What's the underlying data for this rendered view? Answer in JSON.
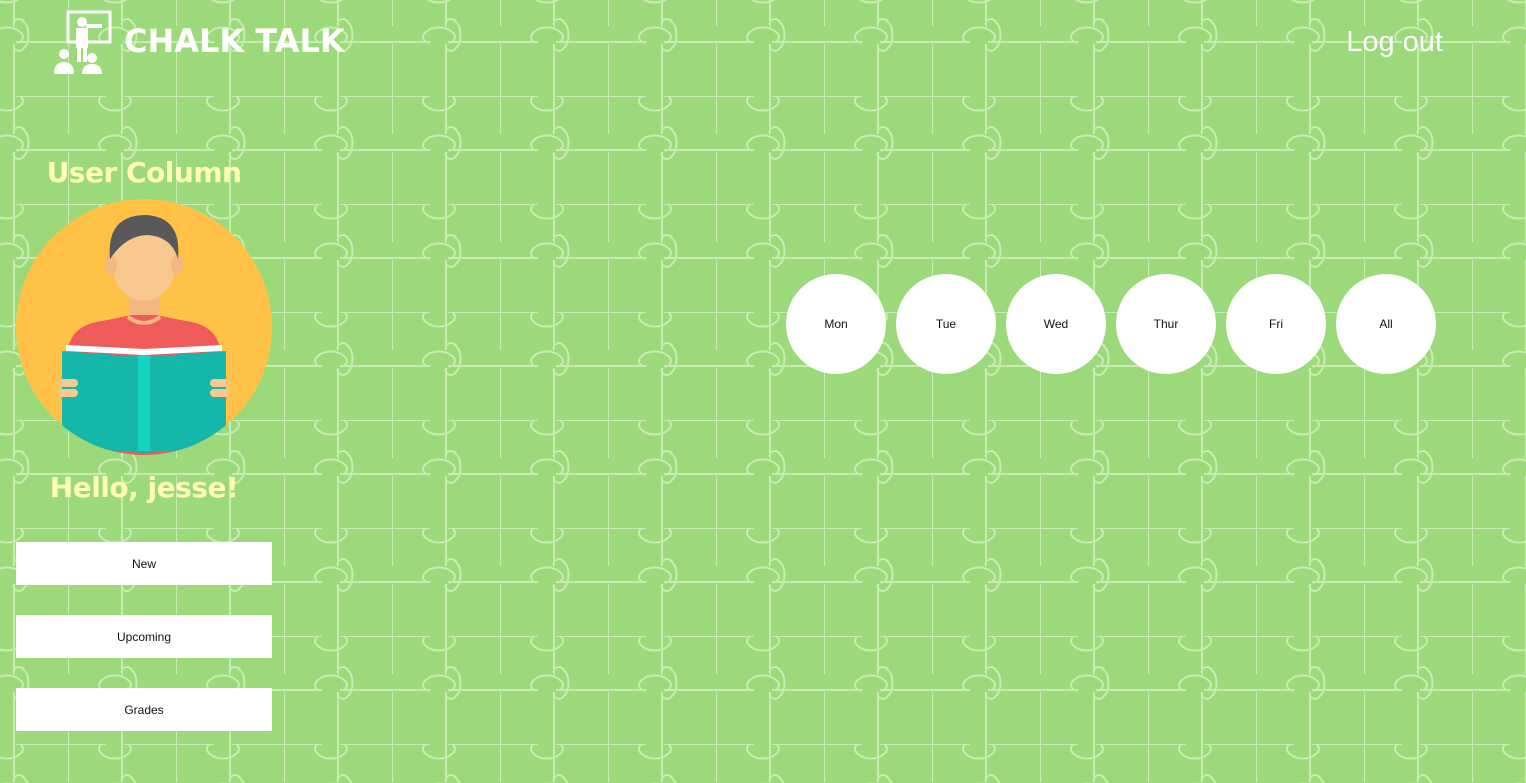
{
  "colors": {
    "background": "#9bd97a",
    "puzzle_lines": "#c8edb0",
    "header_text": "#ffffff",
    "title_text": "#ffffb8",
    "avatar_circle": "#ffc247",
    "book": "#14b7a9",
    "shirt": "#ef5b5b",
    "button_bg": "#ffffff"
  },
  "header": {
    "brand": "CHALK TALK",
    "logo_icon": "teacher-at-board-icon",
    "logout_label": "Log out"
  },
  "user_column": {
    "title": "User Column",
    "avatar_icon": "reading-student-avatar",
    "greeting": "Hello, jesse!",
    "buttons": [
      {
        "label": "New"
      },
      {
        "label": "Upcoming"
      },
      {
        "label": "Grades"
      }
    ]
  },
  "days": [
    {
      "label": "Mon"
    },
    {
      "label": "Tue"
    },
    {
      "label": "Wed"
    },
    {
      "label": "Thur"
    },
    {
      "label": "Fri"
    },
    {
      "label": "All"
    }
  ]
}
